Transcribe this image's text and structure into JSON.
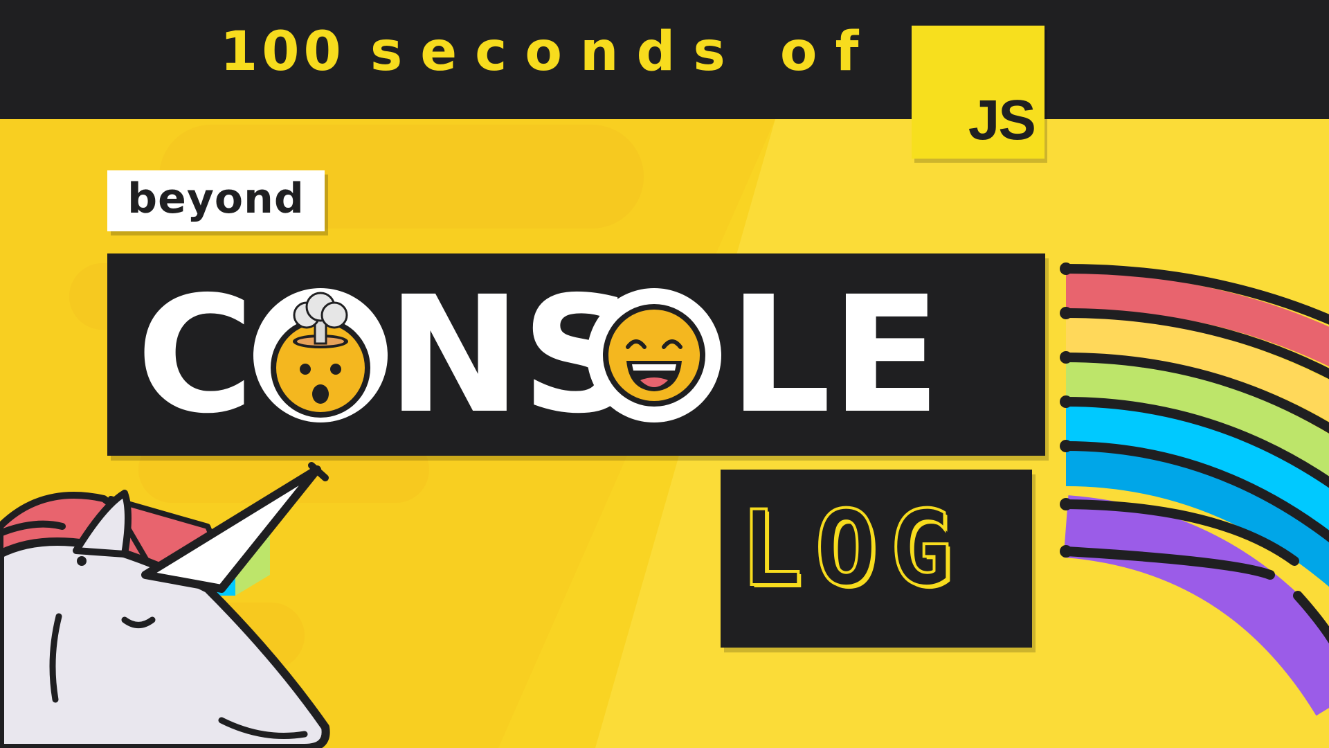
{
  "header": {
    "title_number": "100",
    "title_rest": "seconds of",
    "badge": {
      "label": "JS",
      "color": "#f7df1e"
    }
  },
  "headline": {
    "kicker": "beyond",
    "word_parts": [
      "C",
      "NS",
      "LE"
    ],
    "sub": "LOG"
  },
  "icons": {
    "o1": "exploding-head-emoji",
    "o2": "grinning-face-emoji",
    "mascot": "unicorn-illustration",
    "decoration": "rainbow"
  },
  "colors": {
    "background": "#f9d423",
    "dark": "#1f1f21",
    "accent_yellow": "#f7dc1e",
    "rainbow": [
      "#e8646e",
      "#ffd85a",
      "#bde56a",
      "#00c9ff",
      "#00a6e8",
      "#9b5ce8"
    ]
  }
}
